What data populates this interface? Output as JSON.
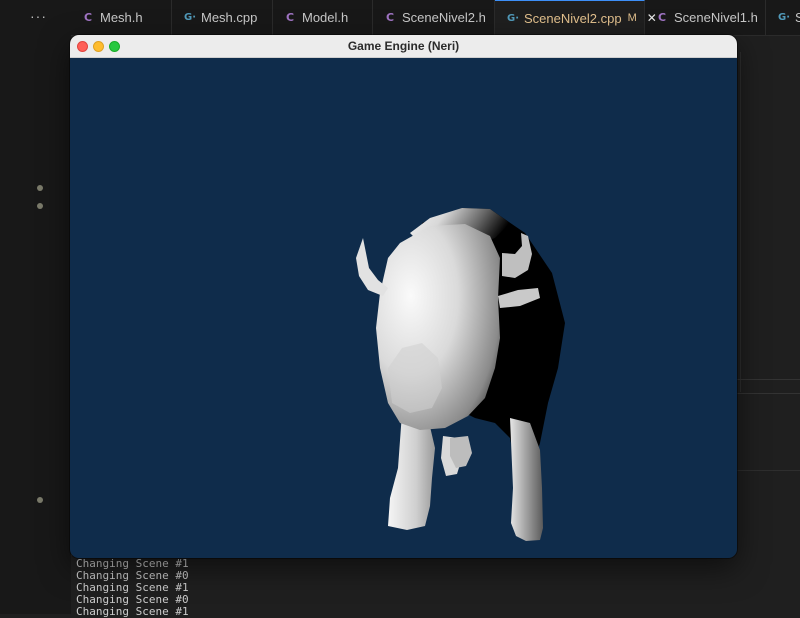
{
  "editor": {
    "more_label": "···",
    "tabs": [
      {
        "label": "Mesh.h",
        "type": "c",
        "icon": "C"
      },
      {
        "label": "Mesh.cpp",
        "type": "cpp",
        "icon": "G·"
      },
      {
        "label": "Model.h",
        "type": "c",
        "icon": "C"
      },
      {
        "label": "SceneNivel2.h",
        "type": "c",
        "icon": "C"
      },
      {
        "label": "SceneNivel2.cpp",
        "type": "cpp",
        "icon": "G·",
        "modified": "M",
        "close": "✕",
        "active": true
      },
      {
        "label": "SceneNivel1.h",
        "type": "c",
        "icon": "C"
      },
      {
        "label": "S",
        "type": "cpp",
        "icon": "G·"
      }
    ]
  },
  "game_window": {
    "title": "Game Engine (Neri)",
    "background_color": "#0f2c4b",
    "subject": "white-shaded 3D bison model"
  },
  "terminal": {
    "lines": [
      "Changing Scene #1",
      "Changing Scene #0",
      "Changing Scene #1",
      "Changing Scene #0",
      "Changing Scene #1"
    ]
  }
}
